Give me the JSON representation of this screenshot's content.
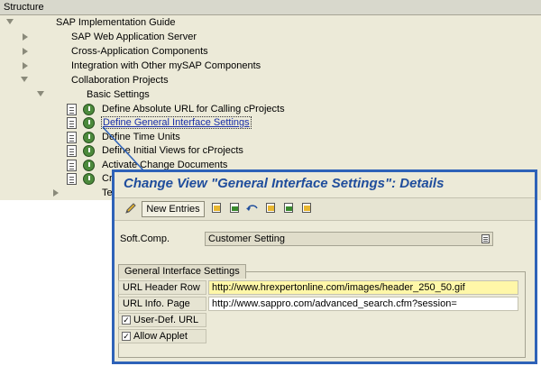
{
  "tree": {
    "header": "Structure",
    "items": [
      {
        "label": "SAP Implementation Guide"
      },
      {
        "label": "SAP Web Application Server"
      },
      {
        "label": "Cross-Application Components"
      },
      {
        "label": "Integration with Other mySAP Components"
      },
      {
        "label": "Collaboration Projects"
      },
      {
        "label": "Basic Settings"
      },
      {
        "label": "Define Absolute URL for Calling cProjects"
      },
      {
        "label": "Define General Interface Settings"
      },
      {
        "label": "Define Time Units"
      },
      {
        "label": "Define Initial Views for cProjects"
      },
      {
        "label": "Activate Change Documents"
      },
      {
        "label": "Cr"
      },
      {
        "label": "Te"
      }
    ]
  },
  "popup": {
    "title": "Change View \"General Interface Settings\": Details",
    "toolbar": {
      "new_entries_label": "New Entries"
    },
    "soft_comp": {
      "label": "Soft.Comp.",
      "value": "Customer Setting"
    },
    "group": {
      "title": "General Interface Settings",
      "url_header_row_label": "URL Header Row",
      "url_header_row_value": "http://www.hrexpertonline.com/images/header_250_50.gif",
      "url_info_page_label": "URL Info. Page",
      "url_info_page_value": "http://www.sappro.com/advanced_search.cfm?session=",
      "user_def_url_label": "User-Def. URL",
      "user_def_url_checked": true,
      "allow_applet_label": "Allow Applet",
      "allow_applet_checked": true
    }
  },
  "colors": {
    "popup_border": "#2e62b8",
    "title_color": "#1f4d9c",
    "link_color": "#1a2fa8",
    "highlight_field": "#fff7a8",
    "activity_icon": "#4c8a3c"
  }
}
